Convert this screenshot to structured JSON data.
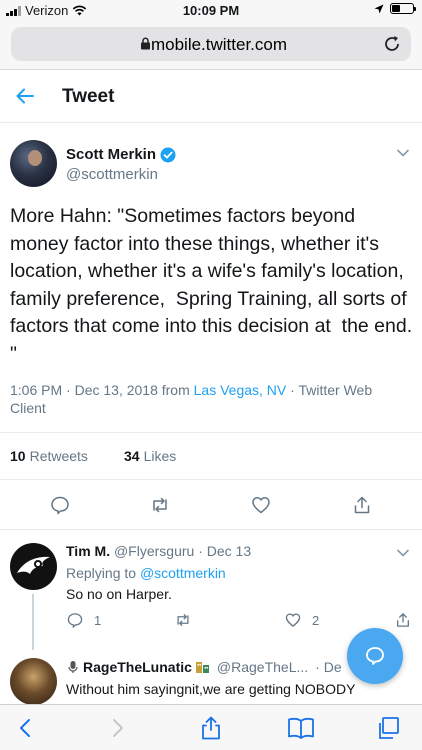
{
  "status_bar": {
    "carrier": "Verizon",
    "time": "10:09 PM",
    "battery_level": 0.4
  },
  "browser": {
    "url": "mobile.twitter.com"
  },
  "header": {
    "title": "Tweet"
  },
  "tweet": {
    "author_name": "Scott Merkin",
    "author_handle": "@scottmerkin",
    "verified": true,
    "text": "More Hahn: \"Sometimes factors beyond money factor into these things, whether it's location, whether it's a wife's family's location, family preference,  Spring Training, all sorts of factors that come into this decision at  the end. \"",
    "meta_prefix": "1:06 PM · Dec 13, 2018 from ",
    "location": "Las Vegas, NV",
    "meta_suffix": " · Twitter Web Client",
    "retweets": "10",
    "retweets_label": "Retweets",
    "likes": "34",
    "likes_label": "Likes"
  },
  "reply": {
    "name": "Tim M.",
    "handle": "@Flyersguru",
    "date": "· Dec 13",
    "replying_prefix": "Replying to ",
    "replying_to": "@scottmerkin",
    "text": "So no on Harper.",
    "reply_count": "1",
    "like_count": "2"
  },
  "reply2": {
    "name": "RageTheLunatic",
    "handle": "@RageTheL...",
    "date": "· De",
    "text": "Without him sayingnit,we are getting NOBODY"
  },
  "colors": {
    "accent": "#1da1f2",
    "fab": "#4aa8f0",
    "secondary_text": "#657786"
  }
}
